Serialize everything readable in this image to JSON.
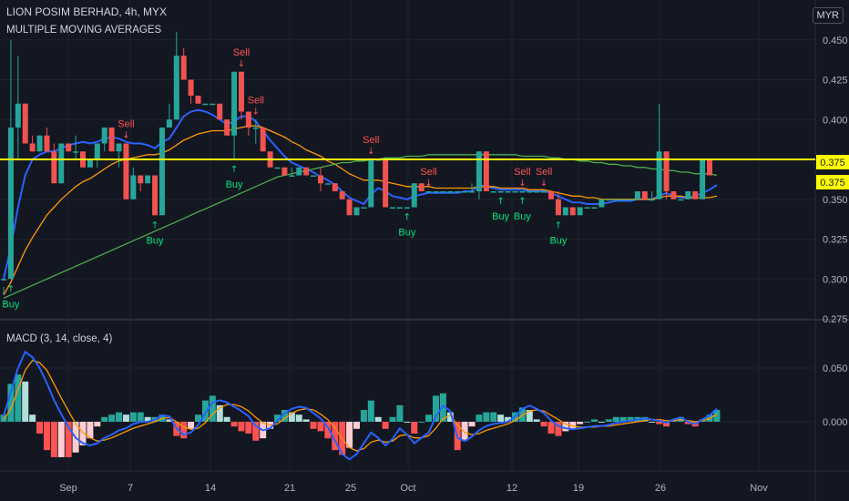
{
  "header": {
    "symbol_line": "LION POSIM BERHAD, 4h, MYX",
    "indicator_name": "MULTIPLE MOVING AVERAGES",
    "currency_button": "MYR"
  },
  "colors": {
    "background": "#131722",
    "grid": "#1f232d",
    "axis_text": "#b2b5be",
    "bull": "#26a69a",
    "bear": "#ef5350",
    "ma_fast": "#2962ff",
    "ma_mid": "#ff9800",
    "ma_slow": "#4caf50",
    "level_line": "#ffff00",
    "buy": "#00e676",
    "sell": "#ff5252",
    "macd_line": "#2962ff",
    "signal_line": "#ff9800"
  },
  "chart_data": [
    {
      "type": "candlestick",
      "title": "LION POSIM BERHAD, 4h, MYX",
      "y_ticks": [
        "0.450",
        "0.425",
        "0.400",
        "0.375",
        "0.350",
        "0.325",
        "0.300",
        "0.275"
      ],
      "ylim": [
        0.275,
        0.475
      ],
      "x_ticks": [
        "Sep",
        "7",
        "14",
        "21",
        "25",
        "Oct",
        "12",
        "19",
        "26",
        "Nov"
      ],
      "price_labels": [
        "0.375",
        "0.375"
      ],
      "horizontal_level": 0.375,
      "candles": [
        [
          0.3,
          0.3,
          0.295,
          0.29
        ],
        [
          0.3,
          0.395,
          0.45,
          0.3
        ],
        [
          0.395,
          0.41,
          0.44,
          0.375
        ],
        [
          0.41,
          0.385,
          0.41,
          0.385
        ],
        [
          0.385,
          0.38,
          0.39,
          0.38
        ],
        [
          0.38,
          0.39,
          0.39,
          0.38
        ],
        [
          0.39,
          0.38,
          0.395,
          0.38
        ],
        [
          0.38,
          0.36,
          0.385,
          0.36
        ],
        [
          0.36,
          0.385,
          0.385,
          0.36
        ],
        [
          0.385,
          0.38,
          0.385,
          0.38
        ],
        [
          0.38,
          0.38,
          0.39,
          0.375
        ],
        [
          0.38,
          0.37,
          0.38,
          0.37
        ],
        [
          0.37,
          0.375,
          0.375,
          0.37
        ],
        [
          0.375,
          0.385,
          0.385,
          0.37
        ],
        [
          0.385,
          0.395,
          0.395,
          0.38
        ],
        [
          0.395,
          0.38,
          0.395,
          0.38
        ],
        [
          0.38,
          0.385,
          0.385,
          0.37
        ],
        [
          0.385,
          0.35,
          0.385,
          0.35
        ],
        [
          0.35,
          0.365,
          0.37,
          0.35
        ],
        [
          0.365,
          0.36,
          0.365,
          0.355
        ],
        [
          0.36,
          0.365,
          0.365,
          0.36
        ],
        [
          0.365,
          0.34,
          0.365,
          0.34
        ],
        [
          0.34,
          0.395,
          0.395,
          0.34
        ],
        [
          0.395,
          0.4,
          0.41,
          0.395
        ],
        [
          0.4,
          0.44,
          0.455,
          0.4
        ],
        [
          0.44,
          0.425,
          0.445,
          0.425
        ],
        [
          0.425,
          0.415,
          0.42,
          0.41
        ],
        [
          0.415,
          0.41,
          0.415,
          0.41
        ],
        [
          0.41,
          0.41,
          0.41,
          0.41
        ],
        [
          0.41,
          0.41,
          0.41,
          0.41
        ],
        [
          0.41,
          0.4,
          0.405,
          0.4
        ],
        [
          0.4,
          0.39,
          0.4,
          0.39
        ],
        [
          0.39,
          0.43,
          0.43,
          0.375
        ],
        [
          0.43,
          0.405,
          0.43,
          0.4
        ],
        [
          0.405,
          0.395,
          0.405,
          0.39
        ],
        [
          0.395,
          0.395,
          0.4,
          0.385
        ],
        [
          0.395,
          0.38,
          0.395,
          0.38
        ],
        [
          0.38,
          0.37,
          0.38,
          0.37
        ],
        [
          0.37,
          0.37,
          0.37,
          0.37
        ],
        [
          0.37,
          0.365,
          0.37,
          0.365
        ],
        [
          0.365,
          0.365,
          0.37,
          0.365
        ],
        [
          0.365,
          0.37,
          0.37,
          0.365
        ],
        [
          0.37,
          0.365,
          0.37,
          0.365
        ],
        [
          0.365,
          0.365,
          0.365,
          0.365
        ],
        [
          0.365,
          0.36,
          0.37,
          0.355
        ],
        [
          0.36,
          0.36,
          0.36,
          0.36
        ],
        [
          0.36,
          0.355,
          0.36,
          0.355
        ],
        [
          0.355,
          0.35,
          0.355,
          0.35
        ],
        [
          0.35,
          0.34,
          0.35,
          0.34
        ],
        [
          0.34,
          0.345,
          0.345,
          0.34
        ],
        [
          0.345,
          0.345,
          0.345,
          0.345
        ],
        [
          0.345,
          0.375,
          0.375,
          0.345
        ],
        [
          0.375,
          0.375,
          0.375,
          0.375
        ],
        [
          0.375,
          0.345,
          0.375,
          0.345
        ],
        [
          0.345,
          0.345,
          0.345,
          0.345
        ],
        [
          0.345,
          0.345,
          0.345,
          0.345
        ],
        [
          0.345,
          0.345,
          0.345,
          0.345
        ],
        [
          0.345,
          0.36,
          0.36,
          0.345
        ],
        [
          0.36,
          0.355,
          0.36,
          0.355
        ],
        [
          0.355,
          0.355,
          0.355,
          0.355
        ],
        [
          0.355,
          0.355,
          0.355,
          0.355
        ],
        [
          0.355,
          0.355,
          0.355,
          0.355
        ],
        [
          0.355,
          0.355,
          0.355,
          0.355
        ],
        [
          0.355,
          0.355,
          0.355,
          0.355
        ],
        [
          0.355,
          0.355,
          0.355,
          0.355
        ],
        [
          0.355,
          0.355,
          0.36,
          0.355
        ],
        [
          0.355,
          0.38,
          0.38,
          0.35
        ],
        [
          0.38,
          0.355,
          0.38,
          0.355
        ],
        [
          0.355,
          0.355,
          0.355,
          0.355
        ],
        [
          0.355,
          0.355,
          0.355,
          0.355
        ],
        [
          0.355,
          0.355,
          0.355,
          0.355
        ],
        [
          0.355,
          0.355,
          0.355,
          0.355
        ],
        [
          0.355,
          0.355,
          0.355,
          0.355
        ],
        [
          0.355,
          0.355,
          0.355,
          0.355
        ],
        [
          0.355,
          0.355,
          0.355,
          0.355
        ],
        [
          0.355,
          0.355,
          0.355,
          0.355
        ],
        [
          0.355,
          0.35,
          0.355,
          0.35
        ],
        [
          0.35,
          0.34,
          0.355,
          0.34
        ],
        [
          0.34,
          0.345,
          0.345,
          0.34
        ],
        [
          0.345,
          0.34,
          0.345,
          0.34
        ],
        [
          0.34,
          0.345,
          0.345,
          0.34
        ],
        [
          0.345,
          0.345,
          0.345,
          0.345
        ],
        [
          0.345,
          0.345,
          0.345,
          0.345
        ],
        [
          0.345,
          0.35,
          0.35,
          0.345
        ],
        [
          0.35,
          0.35,
          0.35,
          0.35
        ],
        [
          0.35,
          0.35,
          0.35,
          0.35
        ],
        [
          0.35,
          0.35,
          0.35,
          0.35
        ],
        [
          0.35,
          0.35,
          0.35,
          0.35
        ],
        [
          0.35,
          0.355,
          0.355,
          0.35
        ],
        [
          0.355,
          0.35,
          0.355,
          0.35
        ],
        [
          0.35,
          0.35,
          0.355,
          0.35
        ],
        [
          0.35,
          0.38,
          0.41,
          0.35
        ],
        [
          0.38,
          0.355,
          0.38,
          0.35
        ],
        [
          0.355,
          0.35,
          0.355,
          0.35
        ],
        [
          0.35,
          0.35,
          0.35,
          0.35
        ],
        [
          0.35,
          0.355,
          0.355,
          0.35
        ],
        [
          0.355,
          0.35,
          0.355,
          0.35
        ],
        [
          0.35,
          0.375,
          0.375,
          0.35
        ],
        [
          0.375,
          0.365,
          0.375,
          0.365
        ]
      ],
      "signals": [
        {
          "type": "Buy",
          "index": 1
        },
        {
          "type": "Sell",
          "index": 17
        },
        {
          "type": "Buy",
          "index": 21
        },
        {
          "type": "Buy",
          "index": 32
        },
        {
          "type": "Sell",
          "index": 33
        },
        {
          "type": "Sell",
          "index": 35
        },
        {
          "type": "Sell",
          "index": 51
        },
        {
          "type": "Buy",
          "index": 56
        },
        {
          "type": "Sell",
          "index": 59
        },
        {
          "type": "Buy",
          "index": 69
        },
        {
          "type": "Sell",
          "index": 72
        },
        {
          "type": "Buy",
          "index": 72
        },
        {
          "type": "Sell",
          "index": 75
        },
        {
          "type": "Buy",
          "index": 77
        }
      ],
      "moving_averages": [
        {
          "name": "fast",
          "color": "#2962ff",
          "values": [
            0.3,
            0.32,
            0.345,
            0.365,
            0.375,
            0.378,
            0.38,
            0.38,
            0.382,
            0.384,
            0.385,
            0.386,
            0.385,
            0.386,
            0.388,
            0.389,
            0.388,
            0.386,
            0.385,
            0.385,
            0.384,
            0.382,
            0.386,
            0.388,
            0.395,
            0.402,
            0.405,
            0.406,
            0.405,
            0.403,
            0.4,
            0.397,
            0.399,
            0.402,
            0.402,
            0.399,
            0.393,
            0.387,
            0.382,
            0.377,
            0.373,
            0.371,
            0.369,
            0.367,
            0.364,
            0.362,
            0.359,
            0.355,
            0.351,
            0.349,
            0.347,
            0.353,
            0.357,
            0.355,
            0.352,
            0.351,
            0.35,
            0.352,
            0.353,
            0.354,
            0.354,
            0.354,
            0.354,
            0.354,
            0.355,
            0.355,
            0.359,
            0.358,
            0.357,
            0.356,
            0.356,
            0.356,
            0.356,
            0.355,
            0.355,
            0.355,
            0.354,
            0.352,
            0.35,
            0.348,
            0.348,
            0.347,
            0.347,
            0.347,
            0.348,
            0.349,
            0.349,
            0.349,
            0.35,
            0.35,
            0.35,
            0.352,
            0.354,
            0.352,
            0.351,
            0.351,
            0.352,
            0.354,
            0.356,
            0.359
          ]
        },
        {
          "name": "mid",
          "color": "#ff9800",
          "values": [
            0.29,
            0.298,
            0.308,
            0.318,
            0.326,
            0.333,
            0.34,
            0.345,
            0.35,
            0.354,
            0.358,
            0.361,
            0.363,
            0.366,
            0.369,
            0.372,
            0.374,
            0.375,
            0.376,
            0.377,
            0.378,
            0.378,
            0.379,
            0.381,
            0.384,
            0.387,
            0.389,
            0.391,
            0.392,
            0.393,
            0.393,
            0.393,
            0.394,
            0.395,
            0.396,
            0.396,
            0.395,
            0.393,
            0.391,
            0.389,
            0.386,
            0.384,
            0.381,
            0.379,
            0.377,
            0.374,
            0.372,
            0.369,
            0.366,
            0.364,
            0.362,
            0.362,
            0.362,
            0.361,
            0.36,
            0.359,
            0.358,
            0.358,
            0.358,
            0.358,
            0.357,
            0.357,
            0.357,
            0.357,
            0.357,
            0.357,
            0.358,
            0.358,
            0.358,
            0.357,
            0.357,
            0.357,
            0.357,
            0.356,
            0.356,
            0.356,
            0.355,
            0.354,
            0.353,
            0.352,
            0.352,
            0.351,
            0.351,
            0.35,
            0.35,
            0.35,
            0.35,
            0.35,
            0.35,
            0.35,
            0.35,
            0.351,
            0.352,
            0.352,
            0.352,
            0.351,
            0.351,
            0.351,
            0.351,
            0.352
          ]
        },
        {
          "name": "slow",
          "color": "#4caf50",
          "values": [
            0.288,
            0.29,
            0.292,
            0.294,
            0.296,
            0.298,
            0.3,
            0.302,
            0.304,
            0.306,
            0.308,
            0.31,
            0.312,
            0.314,
            0.316,
            0.318,
            0.32,
            0.322,
            0.324,
            0.326,
            0.328,
            0.33,
            0.332,
            0.334,
            0.336,
            0.338,
            0.34,
            0.342,
            0.344,
            0.346,
            0.348,
            0.35,
            0.352,
            0.354,
            0.356,
            0.358,
            0.36,
            0.362,
            0.364,
            0.365,
            0.366,
            0.367,
            0.368,
            0.369,
            0.37,
            0.371,
            0.372,
            0.373,
            0.373,
            0.374,
            0.374,
            0.375,
            0.375,
            0.376,
            0.376,
            0.376,
            0.377,
            0.377,
            0.377,
            0.378,
            0.378,
            0.378,
            0.378,
            0.378,
            0.378,
            0.378,
            0.378,
            0.378,
            0.378,
            0.378,
            0.378,
            0.378,
            0.377,
            0.377,
            0.377,
            0.377,
            0.376,
            0.376,
            0.375,
            0.375,
            0.374,
            0.374,
            0.373,
            0.373,
            0.372,
            0.372,
            0.371,
            0.371,
            0.37,
            0.37,
            0.369,
            0.369,
            0.368,
            0.368,
            0.367,
            0.367,
            0.366,
            0.366,
            0.366,
            0.365
          ]
        }
      ]
    },
    {
      "type": "macd",
      "title": "MACD (3, 14, close, 4)",
      "y_ticks": [
        "0.050",
        "0.000"
      ],
      "ylim": [
        -0.045,
        0.07
      ],
      "macd": [
        0.005,
        0.028,
        0.05,
        0.065,
        0.06,
        0.05,
        0.036,
        0.02,
        0.007,
        -0.005,
        -0.015,
        -0.02,
        -0.022,
        -0.02,
        -0.015,
        -0.012,
        -0.008,
        -0.006,
        -0.002,
        0.0,
        0.0,
        0.002,
        0.006,
        0.005,
        -0.006,
        -0.012,
        -0.01,
        -0.003,
        0.008,
        0.018,
        0.02,
        0.018,
        0.014,
        0.01,
        0.005,
        -0.004,
        -0.008,
        -0.006,
        0.001,
        0.008,
        0.012,
        0.014,
        0.013,
        0.008,
        0.003,
        -0.005,
        -0.018,
        -0.03,
        -0.035,
        -0.03,
        -0.02,
        -0.01,
        -0.015,
        -0.022,
        -0.016,
        -0.006,
        -0.012,
        -0.02,
        -0.015,
        -0.01,
        0.005,
        0.015,
        0.01,
        -0.015,
        -0.018,
        -0.014,
        -0.008,
        -0.004,
        -0.002,
        -0.001,
        0.0,
        0.005,
        0.012,
        0.015,
        0.012,
        0.008,
        0.001,
        -0.004,
        -0.006,
        -0.007,
        -0.006,
        -0.005,
        -0.004,
        -0.004,
        -0.003,
        -0.001,
        0.0,
        0.001,
        0.002,
        0.003,
        0.002,
        0.001,
        -0.001,
        0.002,
        0.004,
        0.0,
        -0.002,
        0.002,
        0.006,
        0.012
      ],
      "signal": [
        0.002,
        0.012,
        0.03,
        0.048,
        0.057,
        0.055,
        0.048,
        0.035,
        0.022,
        0.01,
        -0.002,
        -0.01,
        -0.015,
        -0.018,
        -0.017,
        -0.015,
        -0.012,
        -0.009,
        -0.006,
        -0.004,
        -0.002,
        0.0,
        0.003,
        0.004,
        0.0,
        -0.005,
        -0.007,
        -0.006,
        -0.001,
        0.007,
        0.013,
        0.016,
        0.016,
        0.014,
        0.01,
        0.004,
        -0.001,
        -0.003,
        -0.002,
        0.003,
        0.008,
        0.011,
        0.012,
        0.011,
        0.007,
        0.002,
        -0.006,
        -0.016,
        -0.024,
        -0.027,
        -0.025,
        -0.019,
        -0.017,
        -0.019,
        -0.018,
        -0.013,
        -0.012,
        -0.015,
        -0.015,
        -0.013,
        -0.006,
        0.003,
        0.006,
        -0.003,
        -0.01,
        -0.012,
        -0.011,
        -0.008,
        -0.006,
        -0.004,
        -0.002,
        0.001,
        0.006,
        0.01,
        0.011,
        0.01,
        0.006,
        0.002,
        -0.002,
        -0.004,
        -0.005,
        -0.005,
        -0.005,
        -0.004,
        -0.004,
        -0.003,
        -0.002,
        -0.001,
        0.0,
        0.001,
        0.002,
        0.002,
        0.001,
        0.001,
        0.002,
        0.001,
        0.0,
        0.001,
        0.003,
        0.007
      ]
    }
  ]
}
